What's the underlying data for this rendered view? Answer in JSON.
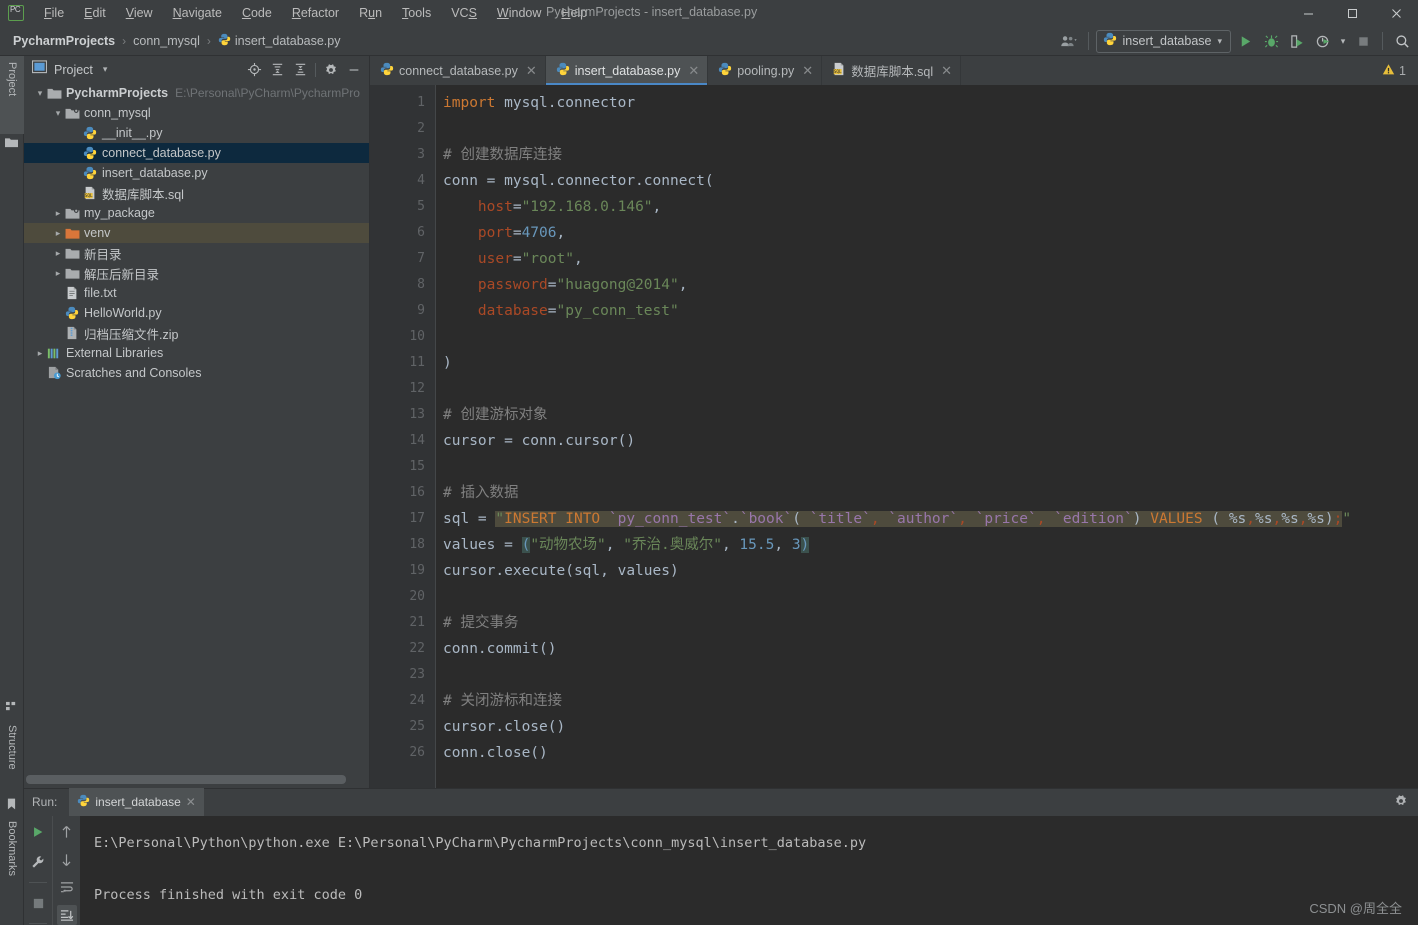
{
  "titlebar": {
    "logo": "pycharm-logo",
    "window_title": "PycharmProjects - insert_database.py",
    "menus": [
      "File",
      "Edit",
      "View",
      "Navigate",
      "Code",
      "Refactor",
      "Run",
      "Tools",
      "VCS",
      "Window",
      "Help"
    ],
    "minimize": "─",
    "maximize": "☐",
    "close": "✕"
  },
  "navbar": {
    "breadcrumbs": [
      {
        "label": "PycharmProjects",
        "bold": true
      },
      {
        "label": "conn_mysql",
        "bold": false
      },
      {
        "label": "insert_database.py",
        "bold": false,
        "icon": "python-file-icon"
      }
    ],
    "separator": "›",
    "run_config": "insert_database",
    "buttons": {
      "user": "user-icon",
      "run": "run-icon",
      "debug": "debug-icon",
      "coverage": "coverage-icon",
      "profile": "profile-icon",
      "stop": "stop-icon",
      "search": "search-icon"
    }
  },
  "left_stripe": {
    "tabs": [
      {
        "label": "Project",
        "selected": true
      },
      {
        "label": "Structure",
        "selected": false
      },
      {
        "label": "Bookmarks",
        "selected": false
      }
    ]
  },
  "project_panel": {
    "title": "Project",
    "caret": "▾",
    "tools": [
      "locate-icon",
      "expand-all-icon",
      "collapse-all-icon",
      "settings-icon",
      "hide-icon"
    ],
    "tree": [
      {
        "indent": 0,
        "arrow": "⌄",
        "icon": "folder-icon",
        "label": "PycharmProjects",
        "bold": true,
        "path": "E:\\Personal\\PyCharm\\PycharmPro",
        "state": "normal"
      },
      {
        "indent": 1,
        "arrow": "⌄",
        "icon": "package-icon",
        "label": "conn_mysql",
        "bold": false,
        "path": "",
        "state": "normal"
      },
      {
        "indent": 2,
        "arrow": "",
        "icon": "python-file-icon",
        "label": "__init__.py",
        "bold": false,
        "path": "",
        "state": "normal"
      },
      {
        "indent": 2,
        "arrow": "",
        "icon": "python-file-icon",
        "label": "connect_database.py",
        "bold": false,
        "path": "",
        "state": "selected"
      },
      {
        "indent": 2,
        "arrow": "",
        "icon": "python-file-icon",
        "label": "insert_database.py",
        "bold": false,
        "path": "",
        "state": "normal"
      },
      {
        "indent": 2,
        "arrow": "",
        "icon": "sql-file-icon",
        "label": "数据库脚本.sql",
        "bold": false,
        "path": "",
        "state": "normal"
      },
      {
        "indent": 1,
        "arrow": "›",
        "icon": "package-icon",
        "label": "my_package",
        "bold": false,
        "path": "",
        "state": "normal"
      },
      {
        "indent": 1,
        "arrow": "›",
        "icon": "venv-folder-icon",
        "label": "venv",
        "bold": false,
        "path": "",
        "state": "highlighted"
      },
      {
        "indent": 1,
        "arrow": "›",
        "icon": "folder-icon",
        "label": "新目录",
        "bold": false,
        "path": "",
        "state": "normal"
      },
      {
        "indent": 1,
        "arrow": "›",
        "icon": "folder-icon",
        "label": "解压后新目录",
        "bold": false,
        "path": "",
        "state": "normal"
      },
      {
        "indent": 1,
        "arrow": "",
        "icon": "text-file-icon",
        "label": "file.txt",
        "bold": false,
        "path": "",
        "state": "normal"
      },
      {
        "indent": 1,
        "arrow": "",
        "icon": "python-file-icon",
        "label": "HelloWorld.py",
        "bold": false,
        "path": "",
        "state": "normal"
      },
      {
        "indent": 1,
        "arrow": "",
        "icon": "zip-file-icon",
        "label": "归档压缩文件.zip",
        "bold": false,
        "path": "",
        "state": "normal"
      },
      {
        "indent": 0,
        "arrow": "›",
        "icon": "libraries-icon",
        "label": "External Libraries",
        "bold": false,
        "path": "",
        "state": "normal"
      },
      {
        "indent": 0,
        "arrow": "",
        "icon": "scratches-icon",
        "label": "Scratches and Consoles",
        "bold": false,
        "path": "",
        "state": "normal"
      }
    ]
  },
  "editor": {
    "tabs": [
      {
        "label": "connect_database.py",
        "icon": "python-file-icon",
        "active": false
      },
      {
        "label": "insert_database.py",
        "icon": "python-file-icon",
        "active": true
      },
      {
        "label": "pooling.py",
        "icon": "python-file-icon",
        "active": false
      },
      {
        "label": "数据库脚本.sql",
        "icon": "sql-file-icon",
        "active": false
      }
    ],
    "close_glyph": "✕",
    "warning_icon": "warning-triangle-icon",
    "warning_count": "1",
    "line_numbers": [
      "1",
      "2",
      "3",
      "4",
      "5",
      "6",
      "7",
      "8",
      "9",
      "10",
      "11",
      "12",
      "13",
      "14",
      "15",
      "16",
      "17",
      "18",
      "19",
      "20",
      "21",
      "22",
      "23",
      "24",
      "25",
      "26"
    ],
    "code": [
      {
        "n": 1,
        "text": "import mysql.connector"
      },
      {
        "n": 2,
        "text": ""
      },
      {
        "n": 3,
        "text": "# 创建数据库连接"
      },
      {
        "n": 4,
        "text": "conn = mysql.connector.connect("
      },
      {
        "n": 5,
        "text": "    host=\"192.168.0.146\","
      },
      {
        "n": 6,
        "text": "    port=4706,"
      },
      {
        "n": 7,
        "text": "    user=\"root\","
      },
      {
        "n": 8,
        "text": "    password=\"huagong@2014\","
      },
      {
        "n": 9,
        "text": "    database=\"py_conn_test\""
      },
      {
        "n": 10,
        "text": ""
      },
      {
        "n": 11,
        "text": ")"
      },
      {
        "n": 12,
        "text": ""
      },
      {
        "n": 13,
        "text": "# 创建游标对象"
      },
      {
        "n": 14,
        "text": "cursor = conn.cursor()"
      },
      {
        "n": 15,
        "text": ""
      },
      {
        "n": 16,
        "text": "# 插入数据"
      },
      {
        "n": 17,
        "text": "sql = \"INSERT INTO `py_conn_test`.`book`( `title`, `author`, `price`, `edition`) VALUES ( %s,%s,%s,%s);\""
      },
      {
        "n": 18,
        "text": "values = (\"动物农场\", \"乔治.奥威尔\", 15.5, 3)"
      },
      {
        "n": 19,
        "text": "cursor.execute(sql, values)"
      },
      {
        "n": 20,
        "text": ""
      },
      {
        "n": 21,
        "text": "# 提交事务"
      },
      {
        "n": 22,
        "text": "conn.commit()"
      },
      {
        "n": 23,
        "text": ""
      },
      {
        "n": 24,
        "text": "# 关闭游标和连接"
      },
      {
        "n": 25,
        "text": "cursor.close()"
      },
      {
        "n": 26,
        "text": "conn.close()"
      }
    ],
    "tokens": {
      "line1": [
        {
          "t": "import",
          "c": "kw"
        },
        {
          "t": " mysql.connector",
          "c": "def"
        }
      ],
      "line3": [
        {
          "t": "# 创建数据库连接",
          "c": "com"
        }
      ],
      "line4": [
        {
          "t": "conn = mysql.connector.connect(",
          "c": "def"
        }
      ],
      "line5": [
        {
          "t": "    ",
          "c": "def"
        },
        {
          "t": "host",
          "c": "kwarg"
        },
        {
          "t": "=",
          "c": "def"
        },
        {
          "t": "\"192.168.0.146\"",
          "c": "str"
        },
        {
          "t": ",",
          "c": "def"
        }
      ],
      "line6": [
        {
          "t": "    ",
          "c": "def"
        },
        {
          "t": "port",
          "c": "kwarg"
        },
        {
          "t": "=",
          "c": "def"
        },
        {
          "t": "4706",
          "c": "num"
        },
        {
          "t": ",",
          "c": "def"
        }
      ],
      "line7": [
        {
          "t": "    ",
          "c": "def"
        },
        {
          "t": "user",
          "c": "kwarg"
        },
        {
          "t": "=",
          "c": "def"
        },
        {
          "t": "\"root\"",
          "c": "str"
        },
        {
          "t": ",",
          "c": "def"
        }
      ],
      "line8": [
        {
          "t": "    ",
          "c": "def"
        },
        {
          "t": "password",
          "c": "kwarg"
        },
        {
          "t": "=",
          "c": "def"
        },
        {
          "t": "\"huagong@2014\"",
          "c": "str"
        },
        {
          "t": ",",
          "c": "def"
        }
      ],
      "line9": [
        {
          "t": "    ",
          "c": "def"
        },
        {
          "t": "database",
          "c": "kwarg"
        },
        {
          "t": "=",
          "c": "def"
        },
        {
          "t": "\"py_conn_test\"",
          "c": "str"
        }
      ]
    }
  },
  "run_panel": {
    "label": "Run:",
    "tab_label": "insert_database",
    "tab_icon": "python-file-icon",
    "close_glyph": "✕",
    "tools_left": [
      "run-icon",
      "wrench-icon",
      "stop-icon"
    ],
    "tools_right": [
      "up-arrow-icon",
      "down-arrow-icon",
      "soft-wrap-icon",
      "scroll-end-icon"
    ],
    "gear": "gear-icon",
    "output": [
      "E:\\Personal\\Python\\python.exe E:\\Personal\\PyCharm\\PycharmProjects\\conn_mysql\\insert_database.py",
      "",
      "Process finished with exit code 0"
    ],
    "watermark": "CSDN @周全全"
  },
  "colors": {
    "bg_panel": "#3c3f41",
    "bg_editor": "#2b2b2b",
    "bg_gutter": "#313335",
    "accent_tab": "#4a88c7",
    "tree_selected": "#0d293e",
    "tree_highlight": "#4e4b3d",
    "keyword": "#cc7832",
    "string": "#6a8759",
    "number": "#6897bb",
    "comment": "#808080",
    "default_text": "#a9b7c6",
    "sql_highlight": "#4e4b3d",
    "run_green": "#59a869",
    "warning_yellow": "#e8bf3b"
  }
}
